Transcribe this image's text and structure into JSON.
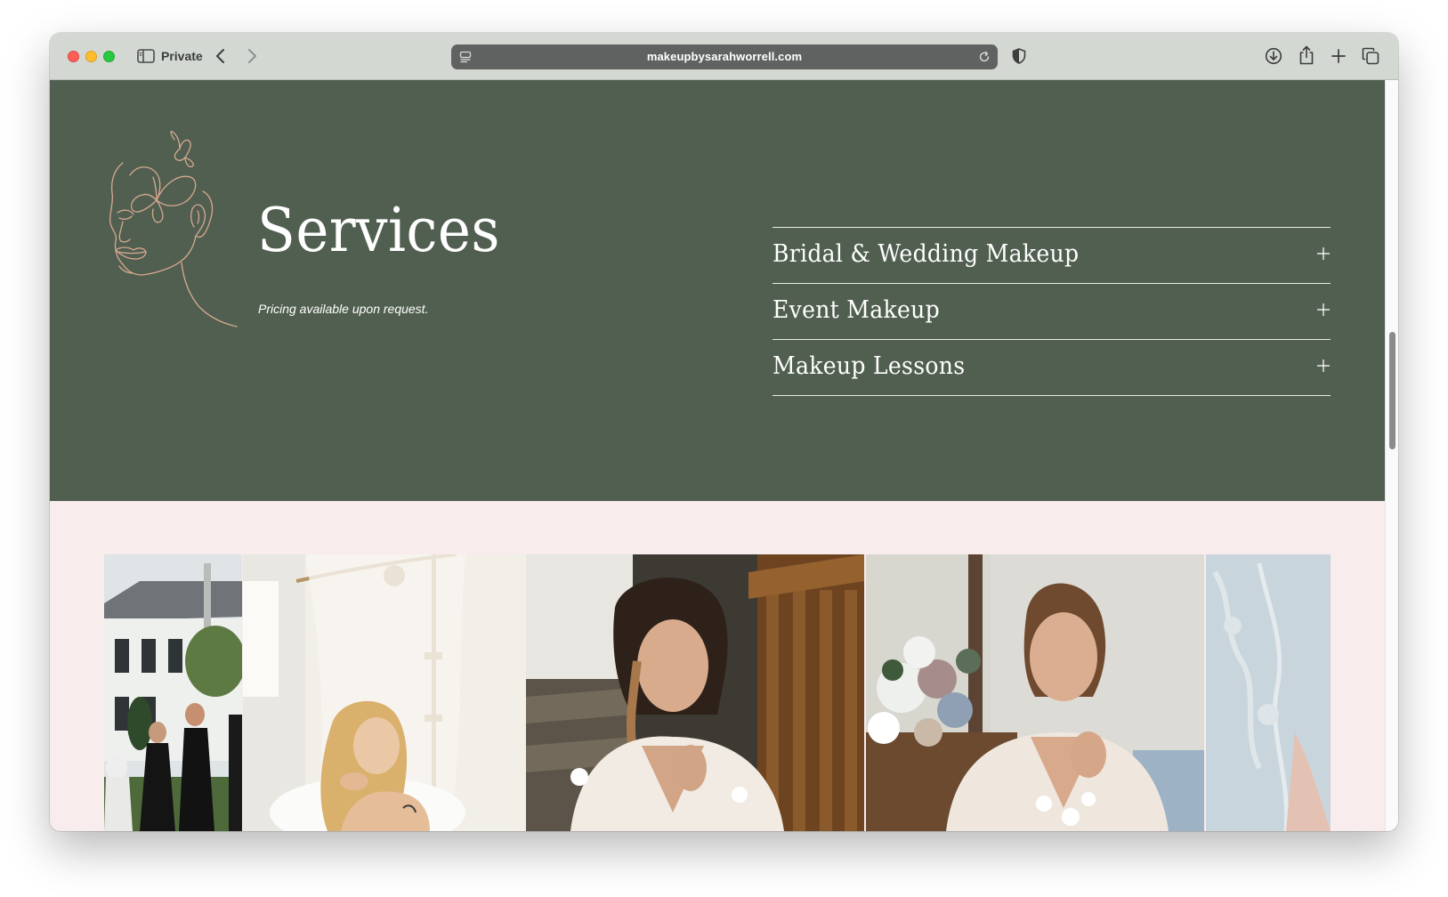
{
  "browser": {
    "mode_label": "Private",
    "url": "makeupbysarahworrell.com"
  },
  "services": {
    "title": "Services",
    "pricing_note": "Pricing available upon request.",
    "items": [
      {
        "label": "Bridal & Wedding Makeup"
      },
      {
        "label": "Event Makeup"
      },
      {
        "label": "Makeup Lessons"
      }
    ]
  },
  "colors": {
    "section_green": "#515f51",
    "page_pink": "#f8ecec",
    "line_art": "#d7a98f"
  },
  "gallery": {
    "photos": [
      {
        "name": "bridesmaids-outdoor-photo"
      },
      {
        "name": "blonde-woman-bathroom-photo"
      },
      {
        "name": "bride-stairs-photo"
      },
      {
        "name": "bride-flowers-photo"
      },
      {
        "name": "partial-lace-photo"
      }
    ]
  }
}
